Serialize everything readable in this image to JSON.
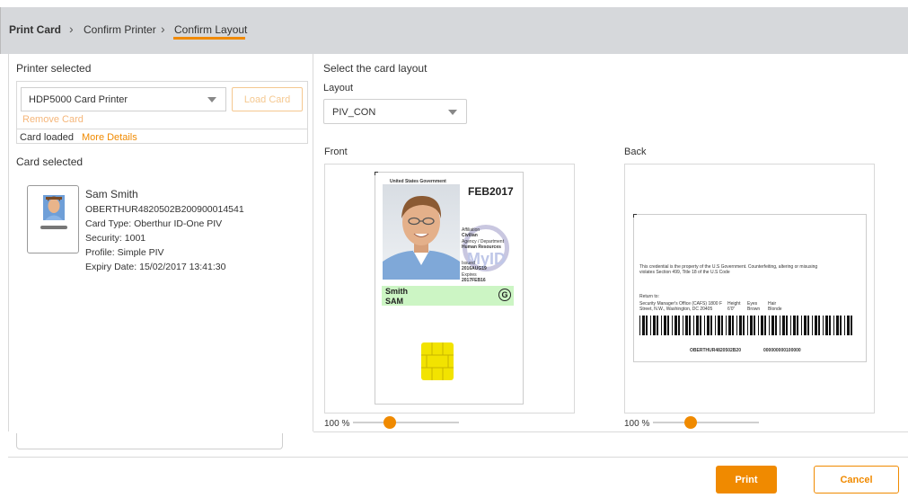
{
  "breadcrumb": {
    "items": [
      "Print Card",
      "Confirm Printer",
      "Confirm Layout"
    ],
    "separator": ">"
  },
  "printer": {
    "section_label": "Printer selected",
    "selected_printer": "HDP5000 Card Printer",
    "load_card_label": "Load Card",
    "remove_card_label": "Remove Card",
    "status_text": "Card loaded",
    "more_details_label": "More Details"
  },
  "card": {
    "section_label": "Card selected",
    "name": "Sam Smith",
    "serial": "OBERTHUR4820502B200900014541",
    "type": "Card Type: Oberthur ID-One PIV",
    "security": "Security: 1001",
    "profile": "Profile: Simple PIV",
    "expiry": "Expiry Date: 15/02/2017 13:41:30"
  },
  "layout": {
    "section_label": "Select the card layout",
    "field_label": "Layout",
    "selected": "PIV_CON",
    "front_label": "Front",
    "back_label": "Back",
    "front_zoom": "100 %",
    "back_zoom": "100 %"
  },
  "front_card": {
    "header": "United States Government",
    "expiry": "FEB2017",
    "affiliation_label": "Affiliation",
    "affiliation": "Civilian",
    "agency_label": "Agency / Department",
    "agency": "Human Resources",
    "issued_label": "Issued",
    "issued": "2016AUG19",
    "expires_label": "Expires",
    "expires": "2017FEB16",
    "surname": "Smith",
    "given_name": "SAM",
    "watermark": "MyID",
    "badge": "G"
  },
  "back_card": {
    "notice": "This credential is the property of the U.S Government. Counterfeiting, altering or misusing violates Section 499, Title 18 of the U.S Code",
    "return_label": "Return to:",
    "return_address_1": "Security Manager's Office (CAFS) 1800 F",
    "return_address_2": "Street, N.W., Washington, DC 20405",
    "height_label": "Height",
    "height": "6'0\"",
    "eyes_label": "Eyes",
    "eyes": "Brown",
    "hair_label": "Hair",
    "hair": "Blonde",
    "serial": "OBERTHUR4820502B20",
    "number": "000000000100000"
  },
  "actions": {
    "print_label": "Print",
    "cancel_label": "Cancel"
  },
  "colors": {
    "accent": "#f08a00",
    "header_bg": "#d6d8db",
    "name_band": "#ccf5c4",
    "chip": "#f2e300"
  }
}
